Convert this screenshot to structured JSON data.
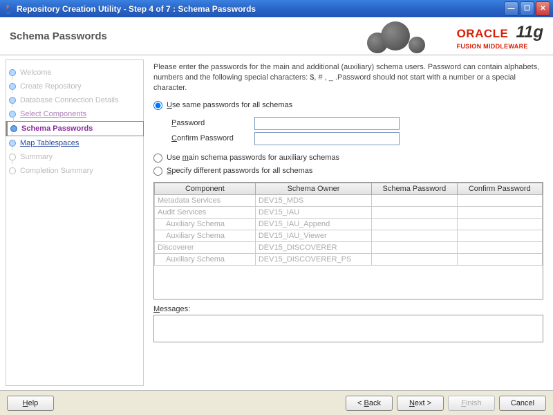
{
  "window": {
    "title": "Repository Creation Utility - Step 4 of 7 : Schema Passwords"
  },
  "header": {
    "heading": "Schema Passwords",
    "brand_main": "ORACLE",
    "brand_sub": "FUSION MIDDLEWARE",
    "brand_version": "11g"
  },
  "sidebar": {
    "steps": [
      {
        "label": "Welcome",
        "state": "done"
      },
      {
        "label": "Create Repository",
        "state": "done"
      },
      {
        "label": "Database Connection Details",
        "state": "done"
      },
      {
        "label": "Select Components",
        "state": "done-link"
      },
      {
        "label": "Schema Passwords",
        "state": "current"
      },
      {
        "label": "Map Tablespaces",
        "state": "next-link"
      },
      {
        "label": "Summary",
        "state": "future"
      },
      {
        "label": "Completion Summary",
        "state": "future"
      }
    ]
  },
  "content": {
    "instructions": "Please enter the passwords for the main and additional (auxiliary) schema users. Password can contain alphabets, numbers and the following special characters: $, # , _ .Password should not start with a number or a special character.",
    "radio_same": "Use same passwords for all schemas",
    "radio_main": "Use main schema passwords for auxiliary schemas",
    "radio_specify": "Specify different passwords for all schemas",
    "selected_radio": "same",
    "pw_label": "Password",
    "confirm_label": "Confirm Password",
    "pw_value": "",
    "confirm_value": "",
    "grid": {
      "headers": [
        "Component",
        "Schema Owner",
        "Schema Password",
        "Confirm Password"
      ],
      "rows": [
        {
          "component": "Metadata Services",
          "owner": "DEV15_MDS",
          "pw": "",
          "cpw": "",
          "indent": false
        },
        {
          "component": "Audit Services",
          "owner": "DEV15_IAU",
          "pw": "",
          "cpw": "",
          "indent": false
        },
        {
          "component": "Auxiliary Schema",
          "owner": "DEV15_IAU_Append",
          "pw": "",
          "cpw": "",
          "indent": true
        },
        {
          "component": "Auxiliary Schema",
          "owner": "DEV15_IAU_Viewer",
          "pw": "",
          "cpw": "",
          "indent": true
        },
        {
          "component": "Discoverer",
          "owner": "DEV15_DISCOVERER",
          "pw": "",
          "cpw": "",
          "indent": false
        },
        {
          "component": "Auxiliary Schema",
          "owner": "DEV15_DISCOVERER_PS",
          "pw": "",
          "cpw": "",
          "indent": true
        }
      ]
    },
    "messages_label": "Messages:",
    "messages_text": ""
  },
  "footer": {
    "help": "Help",
    "back": "< Back",
    "next": "Next >",
    "finish": "Finish",
    "cancel": "Cancel"
  }
}
